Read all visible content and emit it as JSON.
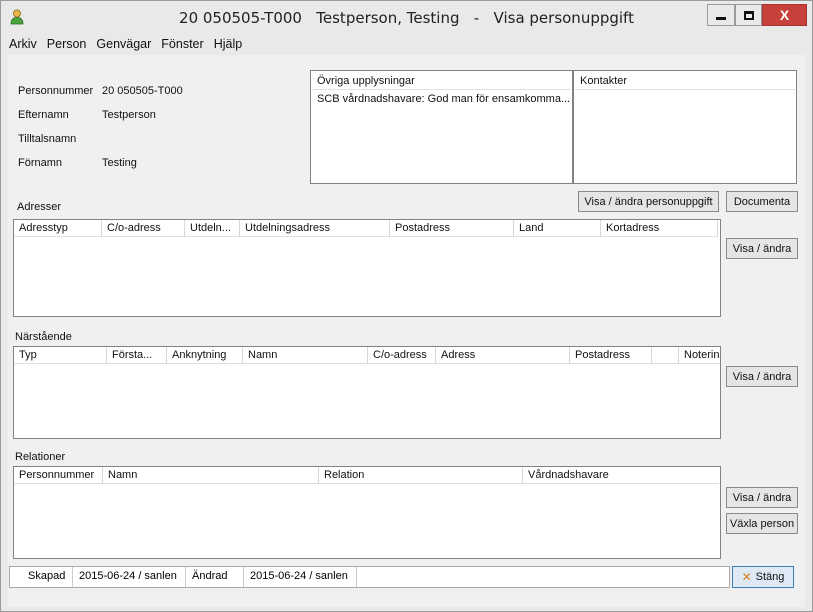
{
  "window": {
    "title": "20 050505-T000   Testperson, Testing   -   Visa personuppgift",
    "minimize_glyph": "—",
    "maximize_glyph": "□",
    "close_glyph": "X"
  },
  "menu": [
    "Arkiv",
    "Person",
    "Genvägar",
    "Fönster",
    "Hjälp"
  ],
  "person": {
    "personnummer_label": "Personnummer",
    "personnummer_value": "20 050505-T000",
    "efternamn_label": "Efternamn",
    "efternamn_value": "Testperson",
    "tilltalsnamn_label": "Tilltalsnamn",
    "tilltalsnamn_value": "",
    "fornamn_label": "Förnamn",
    "fornamn_value": "Testing"
  },
  "ovriga": {
    "header": "Övriga upplysningar",
    "rows": [
      "SCB vårdnadshavare: God man för ensamkomma..."
    ]
  },
  "kontakter": {
    "header": "Kontakter"
  },
  "buttons": {
    "visa_andra_personuppgift": "Visa / ändra personuppgift",
    "documenta": "Documenta",
    "visa_andra_adresser": "Visa / ändra",
    "visa_andra_narstaende": "Visa / ändra",
    "visa_andra_relationer": "Visa / ändra",
    "vaxla_person": "Växla person",
    "stang": "Stäng"
  },
  "adresser": {
    "title": "Adresser",
    "columns": [
      "Adresstyp",
      "C/o-adress",
      "Utdeln...",
      "Utdelningsadress",
      "Postadress",
      "Land",
      "Kortadress"
    ]
  },
  "narstaende": {
    "title": "Närstående",
    "columns": [
      "Typ",
      "Första...",
      "Anknytning",
      "Namn",
      "C/o-adress",
      "Adress",
      "Postadress",
      "",
      "Noterin"
    ]
  },
  "relationer": {
    "title": "Relationer",
    "columns": [
      "Personnummer",
      "Namn",
      "Relation",
      "Vårdnadshavare"
    ]
  },
  "statusbar": {
    "skapad_label": "Skapad",
    "skapad_value": "2015-06-24 / sanlen",
    "andrad_label": "Ändrad",
    "andrad_value": "2015-06-24 / sanlen"
  },
  "icons": {
    "app": "person-icon",
    "close_x": "x-icon"
  },
  "colors": {
    "background": "#f0f0f0",
    "close_button": "#c7403a",
    "stang_x": "#d4801f"
  }
}
